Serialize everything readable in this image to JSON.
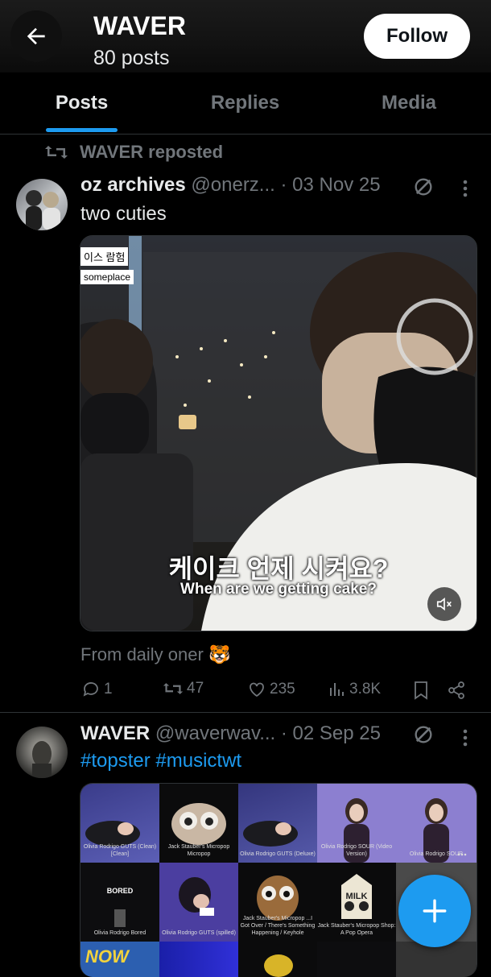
{
  "header": {
    "title": "WAVER",
    "subtitle": "80 posts",
    "follow_label": "Follow"
  },
  "tabs": [
    {
      "label": "Posts"
    },
    {
      "label": "Replies"
    },
    {
      "label": "Media"
    }
  ],
  "post1": {
    "repost_label": "WAVER reposted",
    "display_name": "oz archives",
    "handle": "@onerz...",
    "date": "· 03 Nov 25",
    "text": "two cuties",
    "video_overlay": {
      "tag1": "이스 람험",
      "tag2": "someplace",
      "subtitle_ko": "케이크 언제 시켜요?",
      "subtitle_en": "When are we getting cake?"
    },
    "caption": "From daily oner 🐯",
    "stats": {
      "replies": "1",
      "reposts": "47",
      "likes": "235",
      "views": "3.8K"
    }
  },
  "post2": {
    "display_name": "WAVER",
    "handle": "@waverwav...",
    "date": "· 02 Sep 25",
    "hashtags": "#topster #musictwt",
    "albums_row1": [
      {
        "caption": "Olivia Rodrigo GUTS (Clean) [Clean]"
      },
      {
        "caption": "Jack Stauber's Micropop Micropop"
      },
      {
        "caption": "Olivia Rodrigo GUTS (Deluxe)"
      },
      {
        "caption": "Olivia Rodrigo SOUR (Video Version)"
      },
      {
        "caption": "Olivia Rodrigo SOUR"
      }
    ],
    "albums_row2": [
      {
        "title": "BORED",
        "caption": "Olivia Rodrigo Bored"
      },
      {
        "caption": "Olivia Rodrigo GUTS (spilled)"
      },
      {
        "caption": "Jack Stauber's Micropop ...I Got Over / There's Something Happening / Keyhole"
      },
      {
        "title": "MILK",
        "caption": "Jack Stauber's Micropop Shop: A Pop Opera"
      },
      {
        "caption": ""
      }
    ],
    "albums_row3": [
      {
        "title": "NOW"
      },
      {
        "title": ""
      },
      {
        "title": ""
      },
      {
        "title": ""
      },
      {
        "title": ""
      }
    ]
  },
  "colors": {
    "accent": "#1d9bf0",
    "muted": "#71767b",
    "bg": "#000000"
  },
  "icons": [
    "back-arrow-icon",
    "repost-icon",
    "grok-icon",
    "more-icon",
    "mute-icon",
    "reply-icon",
    "like-icon",
    "views-icon",
    "bookmark-icon",
    "share-icon",
    "plus-icon"
  ]
}
